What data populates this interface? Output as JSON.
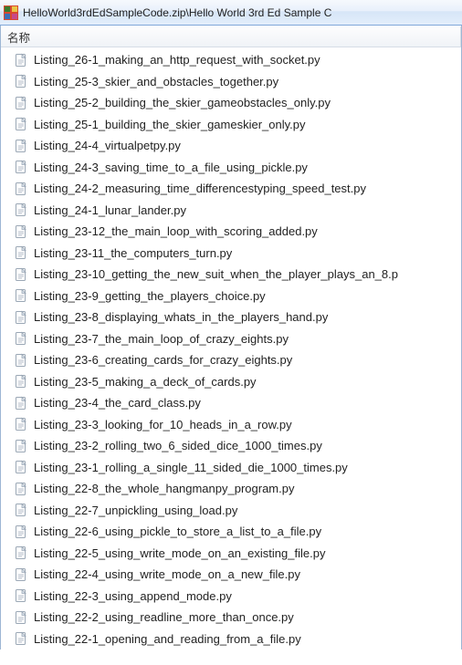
{
  "titlebar": {
    "text": "HelloWorld3rdEdSampleCode.zip\\Hello World 3rd Ed Sample C"
  },
  "header": {
    "name_col": "名称"
  },
  "files": [
    {
      "name": "Listing_26-1_making_an_http_request_with_socket.py"
    },
    {
      "name": "Listing_25-3_skier_and_obstacles_together.py"
    },
    {
      "name": "Listing_25-2_building_the_skier_gameobstacles_only.py"
    },
    {
      "name": "Listing_25-1_building_the_skier_gameskier_only.py"
    },
    {
      "name": "Listing_24-4_virtualpetpy.py"
    },
    {
      "name": "Listing_24-3_saving_time_to_a_file_using_pickle.py"
    },
    {
      "name": "Listing_24-2_measuring_time_differencestyping_speed_test.py"
    },
    {
      "name": "Listing_24-1_lunar_lander.py"
    },
    {
      "name": "Listing_23-12_the_main_loop_with_scoring_added.py"
    },
    {
      "name": "Listing_23-11_the_computers_turn.py"
    },
    {
      "name": "Listing_23-10_getting_the_new_suit_when_the_player_plays_an_8.p"
    },
    {
      "name": "Listing_23-9_getting_the_players_choice.py"
    },
    {
      "name": "Listing_23-8_displaying_whats_in_the_players_hand.py"
    },
    {
      "name": "Listing_23-7_the_main_loop_of_crazy_eights.py"
    },
    {
      "name": "Listing_23-6_creating_cards_for_crazy_eights.py"
    },
    {
      "name": "Listing_23-5_making_a_deck_of_cards.py"
    },
    {
      "name": "Listing_23-4_the_card_class.py"
    },
    {
      "name": "Listing_23-3_looking_for_10_heads_in_a_row.py"
    },
    {
      "name": "Listing_23-2_rolling_two_6_sided_dice_1000_times.py"
    },
    {
      "name": "Listing_23-1_rolling_a_single_11_sided_die_1000_times.py"
    },
    {
      "name": "Listing_22-8_the_whole_hangmanpy_program.py"
    },
    {
      "name": "Listing_22-7_unpickling_using_load.py"
    },
    {
      "name": "Listing_22-6_using_pickle_to_store_a_list_to_a_file.py"
    },
    {
      "name": "Listing_22-5_using_write_mode_on_an_existing_file.py"
    },
    {
      "name": "Listing_22-4_using_write_mode_on_a_new_file.py"
    },
    {
      "name": "Listing_22-3_using_append_mode.py"
    },
    {
      "name": "Listing_22-2_using_readline_more_than_once.py"
    },
    {
      "name": "Listing_22-1_opening_and_reading_from_a_file.py"
    }
  ]
}
